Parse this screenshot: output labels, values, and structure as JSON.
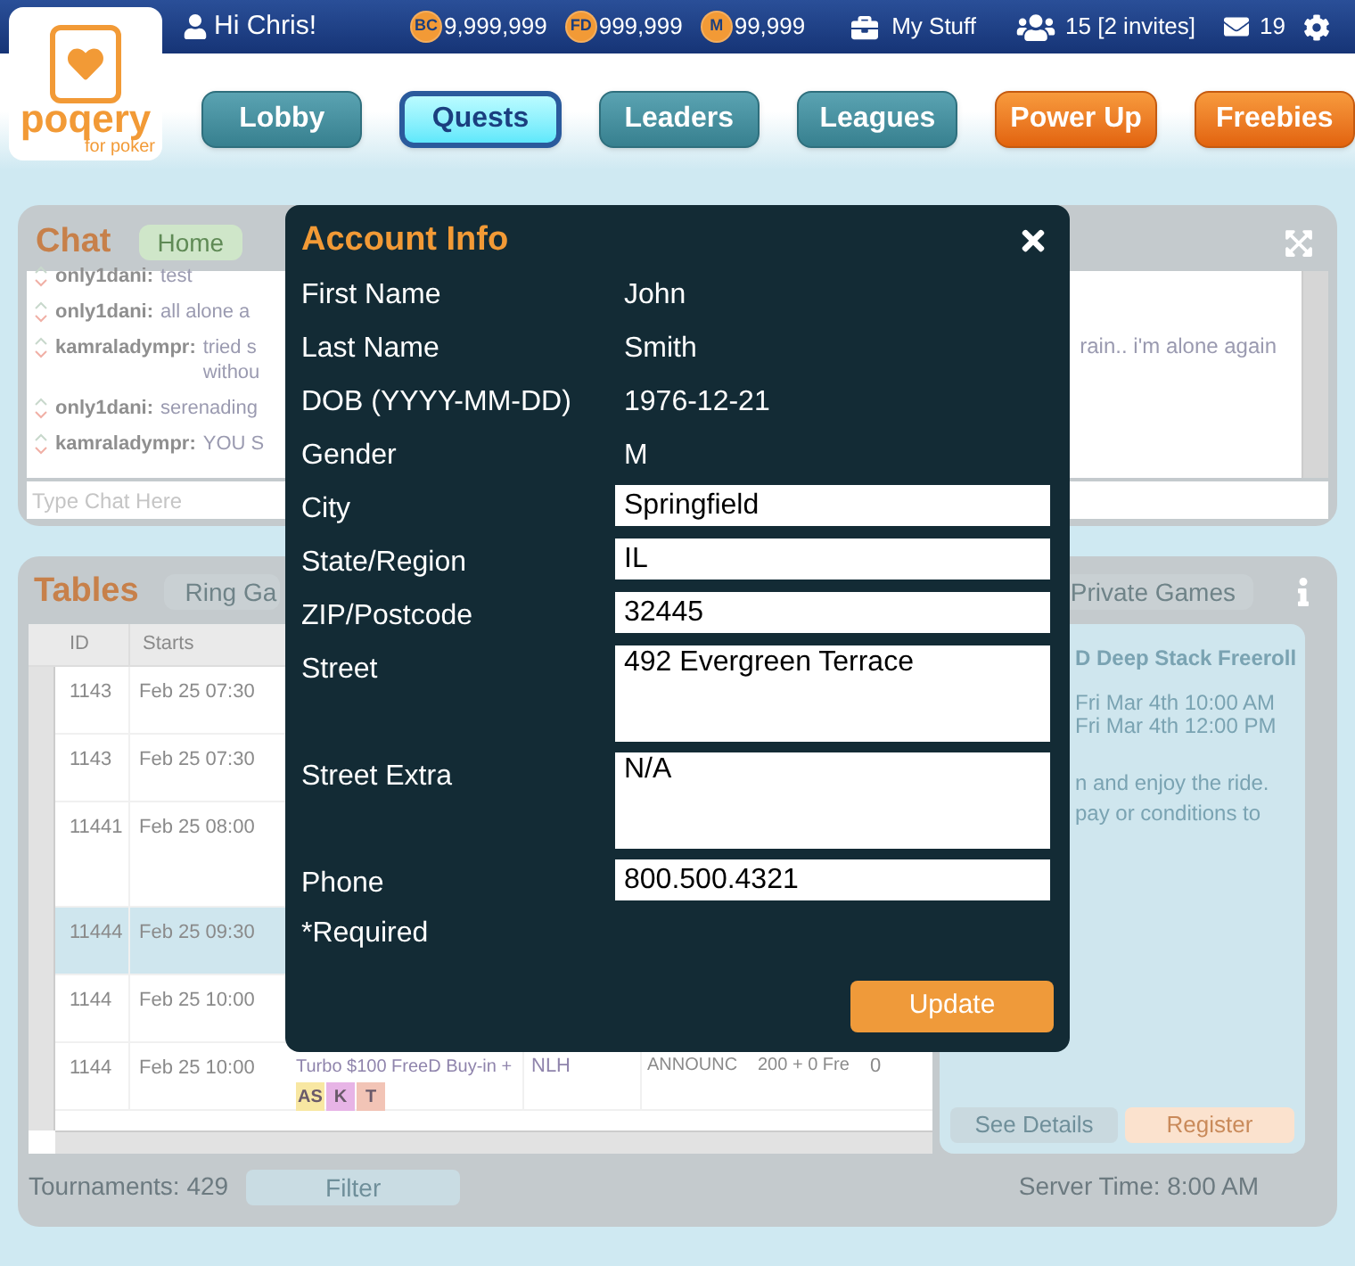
{
  "top_bar": {
    "greeting": "Hi Chris!",
    "currencies": [
      {
        "symbol": "BC",
        "amount": "9,999,999"
      },
      {
        "symbol": "FD",
        "amount": "999,999"
      },
      {
        "symbol": "M",
        "amount": "99,999"
      }
    ],
    "my_stuff": "My Stuff",
    "friends": "15 [2 invites]",
    "messages": "19"
  },
  "logo": {
    "name": "poqery",
    "tagline": "for poker"
  },
  "nav": [
    {
      "label": "Lobby",
      "kind": "normal",
      "selected": false
    },
    {
      "label": "Quests",
      "kind": "normal",
      "selected": true
    },
    {
      "label": "Leaders",
      "kind": "normal",
      "selected": false
    },
    {
      "label": "Leagues",
      "kind": "normal",
      "selected": false
    },
    {
      "label": "Power Up",
      "kind": "promo",
      "selected": false
    },
    {
      "label": "Freebies",
      "kind": "promo",
      "selected": false
    }
  ],
  "chat": {
    "title": "Chat",
    "tabs": [
      {
        "label": "Home",
        "selected": true
      }
    ],
    "messages": [
      {
        "user": "only1dani:",
        "lines": [
          "test"
        ]
      },
      {
        "user": "only1dani:",
        "lines": [
          "all alone a"
        ]
      },
      {
        "user": "kamraladympr:",
        "lines": [
          "tried s",
          "withou"
        ]
      },
      {
        "user": "only1dani:",
        "lines": [
          "serenading"
        ]
      },
      {
        "user": "kamraladympr:",
        "lines": [
          "YOU S"
        ]
      }
    ],
    "overflow_text": "rain.. i'm alone again",
    "input": {
      "placeholder": "Type Chat Here"
    }
  },
  "tables": {
    "title": "Tables",
    "tabs": [
      {
        "label": "Ring Ga",
        "selected": false
      },
      {
        "label": "Private Games",
        "selected": false
      }
    ],
    "columns": [
      "ID",
      "Starts"
    ],
    "rows": [
      {
        "id": "1143",
        "starts": "Feb 25 07:30",
        "selected": false
      },
      {
        "id": "1143",
        "starts": "Feb 25 07:30",
        "selected": false
      },
      {
        "id": "11441",
        "starts": "Feb 25 08:00",
        "selected": false
      },
      {
        "id": "11444",
        "starts": "Feb 25 09:30",
        "selected": true
      },
      {
        "id": "1144",
        "starts": "Feb 25 10:00",
        "selected": false
      },
      {
        "id": "1144",
        "starts": "Feb 25 10:00",
        "selected": false,
        "name": "Turbo $100 FreeD Buy-in +",
        "game": "NLH",
        "status": "ANNOUNC",
        "buy_in": "200 + 0 Fre",
        "column_7": "0",
        "badges": [
          {
            "label": "AS",
            "color": "#f8e7a2"
          },
          {
            "label": "K",
            "color": "#e7b4e6"
          },
          {
            "label": "T",
            "color": "#f2c4b6"
          }
        ]
      }
    ],
    "footer": {
      "count": "Tournaments: 429",
      "filter": "Filter",
      "server_time": "Server Time: 8:00 AM"
    },
    "featured": {
      "title": "D Deep Stack Freeroll",
      "times": [
        "Fri Mar 4th 10:00 AM",
        "Fri Mar 4th 12:00 PM"
      ],
      "description": [
        "n and enjoy the ride.",
        "pay or conditions to"
      ],
      "buttons": [
        {
          "label": "See Details",
          "kind": "secondary"
        },
        {
          "label": "Register",
          "kind": "primary"
        }
      ]
    }
  },
  "modal": {
    "title": "Account Info",
    "fields": [
      {
        "label": "First Name",
        "value": "John",
        "kind": "text"
      },
      {
        "label": "Last Name",
        "value": "Smith",
        "kind": "text"
      },
      {
        "label": "DOB (YYYY-MM-DD)",
        "value": "1976-12-21",
        "kind": "text"
      },
      {
        "label": "Gender",
        "value": "M",
        "kind": "text"
      },
      {
        "label": "City",
        "value": "Springfield",
        "kind": "input"
      },
      {
        "label": "State/Region",
        "value": "IL",
        "kind": "input"
      },
      {
        "label": "ZIP/Postcode",
        "value": "32445",
        "kind": "input"
      },
      {
        "label": "Street",
        "value": "492 Evergreen Terrace",
        "kind": "textarea"
      },
      {
        "label": "Street Extra",
        "value": "N/A",
        "kind": "textarea"
      },
      {
        "label": "Phone",
        "value": "800.500.4321",
        "kind": "input"
      }
    ],
    "required_note": "*Required",
    "button": "Update"
  }
}
